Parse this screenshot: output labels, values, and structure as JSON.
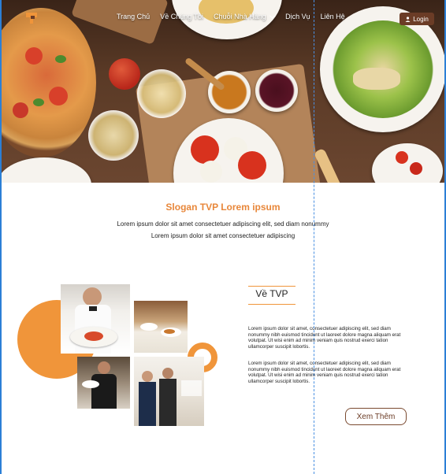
{
  "nav": {
    "items": [
      "Trang Chủ",
      "Về Chúng Tôi",
      "Chuỗi Nhà Hàng",
      "Dịch Vụ",
      "Liên Hệ"
    ],
    "dropdown_item_index": 2,
    "login_label": "Login"
  },
  "hero": {
    "slogan": "Slogan TVP Lorem ipsum",
    "line1": "Lorem ipsum dolor sit amet consectetuer adipiscing elit, sed diam nonummy",
    "line2": "Lorem ipsum dolor sit amet consectetuer adipiscing"
  },
  "about": {
    "title": "Về TVP",
    "paragraph1": "Lorem ipsum dolor sit amet, consectetuer adipiscing elit, sed diam nonummy nibh euismod tincidunt ut laoreet dolore magna aliquam erat volutpat. Ut wisi enim ad minim veniam quis nostrud exerci tation ullamcorper suscipit lobortis.",
    "paragraph2": "Lorem ipsum dolor sit amet, consectetuer adipiscing elit, sed diam nonummy nibh euismod tincidunt ut laoreet dolore magna aliquam erat volutpat. Ut wisi enim ad minim veniam quis nostrud exerci tation ullamcorper suscipit lobortis.",
    "button_label": "Xem Thêm"
  },
  "colors": {
    "accent": "#f0953a",
    "brown": "#6b3c26",
    "guide": "#2b7fd6"
  }
}
